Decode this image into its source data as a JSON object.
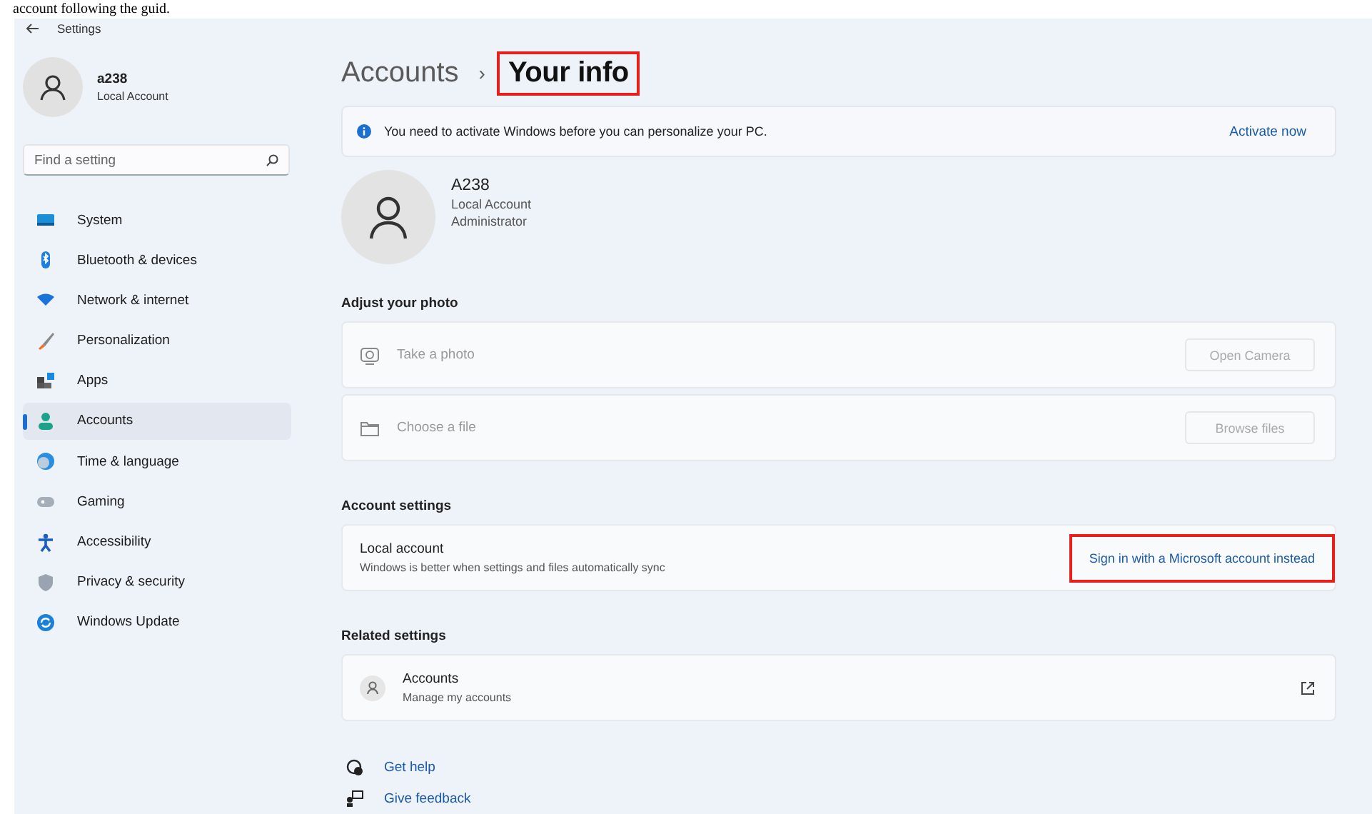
{
  "document_text": "account following the guid.",
  "window": {
    "title": "Settings"
  },
  "user": {
    "name": "a238",
    "type": "Local Account"
  },
  "search": {
    "placeholder": "Find a setting"
  },
  "sidebar": {
    "items": [
      {
        "label": "System",
        "selected": false
      },
      {
        "label": "Bluetooth & devices",
        "selected": false
      },
      {
        "label": "Network & internet",
        "selected": false
      },
      {
        "label": "Personalization",
        "selected": false
      },
      {
        "label": "Apps",
        "selected": false
      },
      {
        "label": "Accounts",
        "selected": true
      },
      {
        "label": "Time & language",
        "selected": false
      },
      {
        "label": "Gaming",
        "selected": false
      },
      {
        "label": "Accessibility",
        "selected": false
      },
      {
        "label": "Privacy & security",
        "selected": false
      },
      {
        "label": "Windows Update",
        "selected": false
      }
    ]
  },
  "breadcrumb": [
    {
      "label": "Accounts",
      "highlighted": false
    },
    {
      "label": "Your info",
      "highlighted": true
    }
  ],
  "breadcrumb_separator": "›",
  "banner": {
    "message": "You need to activate Windows before you can personalize your PC.",
    "action": "Activate now"
  },
  "profile": {
    "name": "A238",
    "type": "Local Account",
    "role": "Administrator"
  },
  "sections": [
    {
      "title": "Adjust your photo",
      "cards": [
        {
          "kind": "camera",
          "title": "Take a photo",
          "button": "Open Camera",
          "disabled": true
        },
        {
          "kind": "file",
          "title": "Choose a file",
          "button": "Browse files",
          "disabled": true
        }
      ]
    },
    {
      "title": "Account settings",
      "cards": [
        {
          "kind": "link",
          "title": "Local account",
          "subtitle": "Windows is better when settings and files automatically sync",
          "link": "Sign in with a Microsoft account instead",
          "highlighted": true
        }
      ]
    },
    {
      "title": "Related settings",
      "cards": [
        {
          "kind": "external",
          "title": "Accounts",
          "subtitle": "Manage my accounts"
        }
      ]
    }
  ],
  "footer_links": [
    "Get help",
    "Give feedback"
  ]
}
